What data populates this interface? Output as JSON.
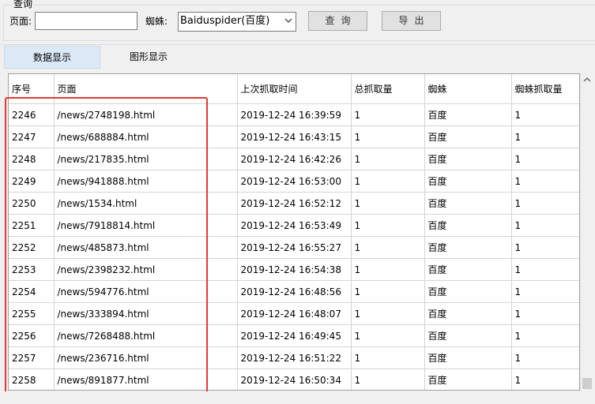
{
  "query_group": {
    "title": "查询",
    "page_label": "页面:",
    "page_value": "",
    "spider_label": "蜘蛛:",
    "spider_selected": "Baiduspider(百度)",
    "query_button": "查询",
    "export_button": "导出"
  },
  "tabs": [
    {
      "label": "数据显示",
      "active": true
    },
    {
      "label": "图形显示",
      "active": false
    }
  ],
  "table": {
    "columns": [
      "序号",
      "页面",
      "上次抓取时间",
      "总抓取量",
      "蜘蛛",
      "蜘蛛抓取量"
    ],
    "rows": [
      [
        "2246",
        "/news/2748198.html",
        "2019-12-24 16:39:59",
        "1",
        "百度",
        "1"
      ],
      [
        "2247",
        "/news/688884.html",
        "2019-12-24 16:43:15",
        "1",
        "百度",
        "1"
      ],
      [
        "2248",
        "/news/217835.html",
        "2019-12-24 16:42:26",
        "1",
        "百度",
        "1"
      ],
      [
        "2249",
        "/news/941888.html",
        "2019-12-24 16:53:00",
        "1",
        "百度",
        "1"
      ],
      [
        "2250",
        "/news/1534.html",
        "2019-12-24 16:52:12",
        "1",
        "百度",
        "1"
      ],
      [
        "2251",
        "/news/7918814.html",
        "2019-12-24 16:53:49",
        "1",
        "百度",
        "1"
      ],
      [
        "2252",
        "/news/485873.html",
        "2019-12-24 16:55:27",
        "1",
        "百度",
        "1"
      ],
      [
        "2253",
        "/news/2398232.html",
        "2019-12-24 16:54:38",
        "1",
        "百度",
        "1"
      ],
      [
        "2254",
        "/news/594776.html",
        "2019-12-24 16:48:56",
        "1",
        "百度",
        "1"
      ],
      [
        "2255",
        "/news/333894.html",
        "2019-12-24 16:48:07",
        "1",
        "百度",
        "1"
      ],
      [
        "2256",
        "/news/7268488.html",
        "2019-12-24 16:49:45",
        "1",
        "百度",
        "1"
      ],
      [
        "2257",
        "/news/236716.html",
        "2019-12-24 16:51:22",
        "1",
        "百度",
        "1"
      ],
      [
        "2258",
        "/news/891877.html",
        "2019-12-24 16:50:34",
        "1",
        "百度",
        "1"
      ]
    ]
  },
  "colors": {
    "highlight": "#e53935",
    "active_tab": "#dbe9f7"
  }
}
